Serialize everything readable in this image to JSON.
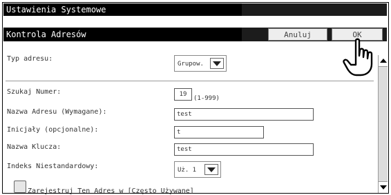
{
  "header": {
    "app_title": "Ustawienia Systemowe",
    "section_title": "Kontrola Adresów",
    "cancel_label": "Anuluj",
    "ok_label": "OK"
  },
  "form": {
    "address_type_label": "Typ adresu:",
    "address_type_value": "Grupow.",
    "search_number_label": "Szukaj Numer:",
    "search_number_value": "19",
    "search_number_range": "(1-999)",
    "address_name_label": "Nazwa Adresu (Wymagane):",
    "address_name_value": "test",
    "initials_label": "Inicjały (opcjonalne):",
    "initials_value": "t",
    "key_name_label": "Nazwa Klucza:",
    "key_name_value": "test",
    "custom_index_label": "Indeks Niestandardowy:",
    "custom_index_value": "Uż. 1",
    "register_frequent_label": "Zarejestruj Ten Adres w [Często Używane]"
  }
}
